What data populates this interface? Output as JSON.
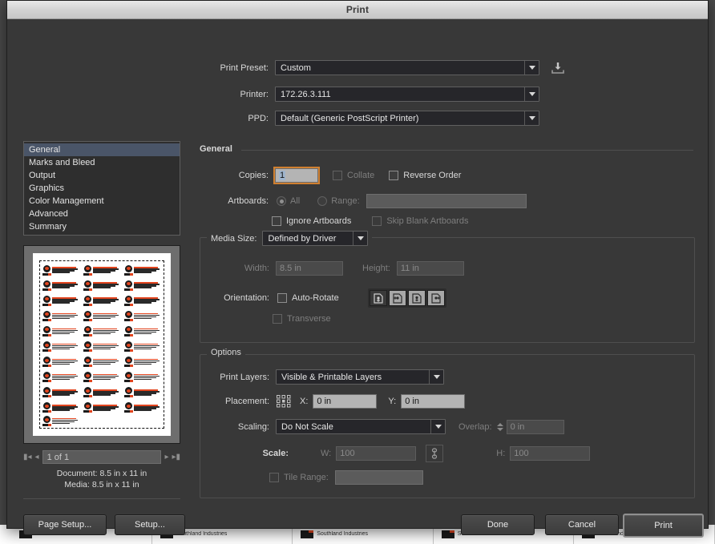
{
  "window": {
    "title": "Print"
  },
  "top": {
    "preset": {
      "label": "Print Preset:",
      "value": "Custom"
    },
    "printer": {
      "label": "Printer:",
      "value": "172.26.3.111"
    },
    "ppd": {
      "label": "PPD:",
      "value": "Default (Generic PostScript Printer)"
    },
    "save_preset_icon": "save-preset-icon"
  },
  "nav": {
    "items": [
      {
        "label": "General",
        "selected": true
      },
      {
        "label": "Marks and Bleed",
        "selected": false
      },
      {
        "label": "Output",
        "selected": false
      },
      {
        "label": "Graphics",
        "selected": false
      },
      {
        "label": "Color Management",
        "selected": false
      },
      {
        "label": "Advanced",
        "selected": false
      },
      {
        "label": "Summary",
        "selected": false
      }
    ]
  },
  "preview": {
    "page_nav_value": "1 of 1",
    "document_info": "Document:  8.5 in x 11 in",
    "media_info": "Media:  8.5 in x 11 in",
    "first_icon": "first-page-icon",
    "prev_icon": "previous-page-icon",
    "next_icon": "next-page-icon",
    "last_icon": "last-page-icon"
  },
  "general": {
    "section_title": "General",
    "copies": {
      "label": "Copies:",
      "value": "1"
    },
    "collate": {
      "label": "Collate",
      "checked": false,
      "enabled": false
    },
    "reverse_order": {
      "label": "Reverse Order",
      "checked": false,
      "enabled": true
    },
    "artboards": {
      "label": "Artboards:",
      "all_label": "All",
      "all_selected": true,
      "range_label": "Range:",
      "range_value": ""
    },
    "ignore_artboards": {
      "label": "Ignore Artboards",
      "checked": false,
      "enabled": true
    },
    "skip_blank_artboards": {
      "label": "Skip Blank Artboards",
      "checked": false,
      "enabled": false
    }
  },
  "media": {
    "legend": "Media Size:",
    "size_value": "Defined by Driver",
    "width": {
      "label": "Width:",
      "value": "8.5 in",
      "enabled": false
    },
    "height": {
      "label": "Height:",
      "value": "11 in",
      "enabled": false
    },
    "orientation": {
      "label": "Orientation:"
    },
    "auto_rotate": {
      "label": "Auto-Rotate",
      "checked": false,
      "enabled": true
    },
    "transverse": {
      "label": "Transverse",
      "checked": false,
      "enabled": false
    },
    "orientation_buttons": [
      {
        "name": "orientation-portrait-icon",
        "selected": true
      },
      {
        "name": "orientation-landscape-icon",
        "selected": false
      },
      {
        "name": "orientation-portrait-flipped-icon",
        "selected": false
      },
      {
        "name": "orientation-landscape-flipped-icon",
        "selected": false
      }
    ]
  },
  "options": {
    "legend": "Options",
    "print_layers": {
      "label": "Print Layers:",
      "value": "Visible & Printable Layers"
    },
    "placement": {
      "label": "Placement:",
      "anchor_icon": "placement-anchor-grid-icon",
      "x_label": "X:",
      "x_value": "0 in",
      "y_label": "Y:",
      "y_value": "0 in"
    },
    "scaling": {
      "label": "Scaling:",
      "value": "Do Not Scale"
    },
    "overlap": {
      "label": "Overlap:",
      "value": "0 in",
      "enabled": false
    },
    "scale": {
      "label": "Scale:",
      "w_label": "W:",
      "w_value": "100",
      "h_label": "H:",
      "h_value": "100",
      "link_icon": "link-constrain-icon",
      "enabled": false
    },
    "tile_range": {
      "label": "Tile Range:",
      "value": "",
      "checked": false,
      "enabled": false
    }
  },
  "footer": {
    "page_setup": "Page Setup...",
    "setup": "Setup...",
    "done": "Done",
    "cancel": "Cancel",
    "print": "Print"
  },
  "background": {
    "label_text": "Southland Industries"
  },
  "colors": {
    "dialog_bg": "#383838",
    "select_bg": "#26262a",
    "input_bg": "#b4b4b4",
    "nav_selected": "#4a5568",
    "focus_ring": "#d08030",
    "accent_orange": "#e2451f"
  }
}
